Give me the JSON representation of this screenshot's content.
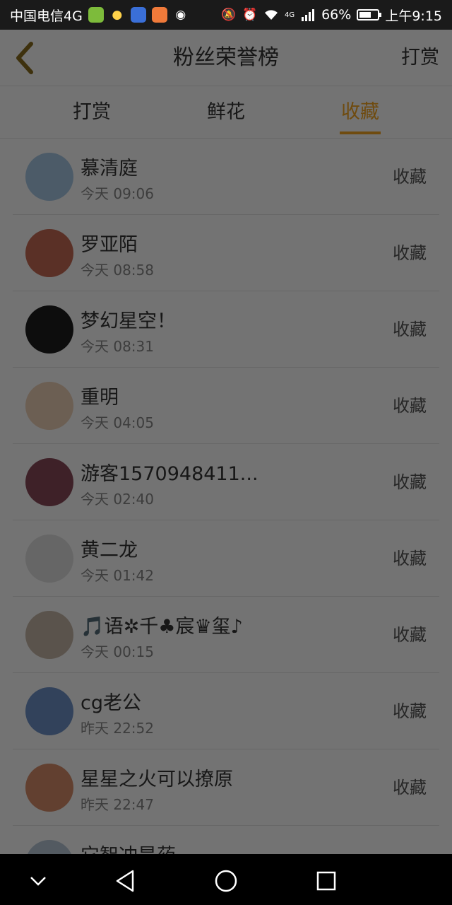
{
  "status_bar": {
    "carrier": "中国电信4G",
    "network_badge": "4G",
    "battery": "66%",
    "battery_level": 0.66,
    "time": "上午9:15",
    "icons": [
      "app-green-icon",
      "bulb-icon",
      "app-blue-icon",
      "video-app-icon",
      "audio-app-icon",
      "mute-icon",
      "alarm-icon",
      "wifi-icon",
      "signal-icon",
      "battery-icon"
    ]
  },
  "header": {
    "back_icon": "chevron-left-icon",
    "title": "粉丝荣誉榜",
    "action_label": "打赏"
  },
  "tabs": [
    {
      "label": "打赏",
      "active": false
    },
    {
      "label": "鲜花",
      "active": false
    },
    {
      "label": "收藏",
      "active": true
    }
  ],
  "fans": [
    {
      "name": "慕清庭",
      "time": "今天 09:06",
      "action": "收藏",
      "avatar_color": "#a9c9e6"
    },
    {
      "name": "罗亚陌",
      "time": "今天 08:58",
      "action": "收藏",
      "avatar_color": "#c76a55"
    },
    {
      "name": "梦幻星空！",
      "time": "今天 08:31",
      "action": "收藏",
      "avatar_color": "#1e1e1e"
    },
    {
      "name": "重明",
      "time": "今天 04:05",
      "action": "收藏",
      "avatar_color": "#efd2b8"
    },
    {
      "name": "游客1570948411...",
      "time": "今天 02:40",
      "action": "收藏",
      "avatar_color": "#8a4a5a"
    },
    {
      "name": "黄二龙",
      "time": "今天 01:42",
      "action": "收藏",
      "avatar_color": "#e2e2e2"
    },
    {
      "name": "🎵语✲千♣宸♛玺♪",
      "time": "今天 00:15",
      "action": "收藏",
      "avatar_color": "#c8b9a8"
    },
    {
      "name": "cg老公",
      "time": "昨天 22:52",
      "action": "收藏",
      "avatar_color": "#6f93c9"
    },
    {
      "name": "星星之火可以撩原",
      "time": "昨天 22:47",
      "action": "收藏",
      "avatar_color": "#d98f6b"
    },
    {
      "name": "它智冲是药",
      "time": "",
      "action": "",
      "avatar_color": "#b9c7d8"
    }
  ],
  "nav_bar": {
    "icons": [
      "collapse-chevron-icon",
      "back-triangle-icon",
      "home-circle-icon",
      "recents-square-icon"
    ]
  }
}
